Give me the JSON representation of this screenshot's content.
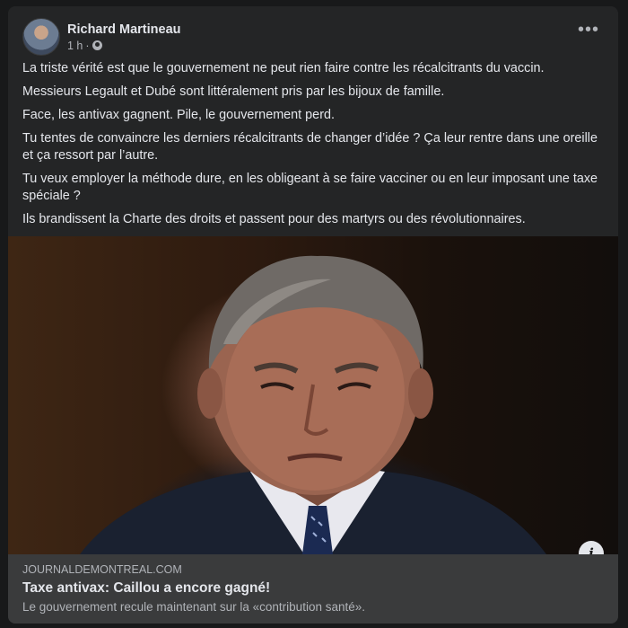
{
  "post": {
    "author": "Richard Martineau",
    "time": "1 h",
    "separator": "·",
    "more_icon": "more-horizontal-icon",
    "privacy_icon": "globe-icon",
    "paragraphs": [
      "La triste vérité est que le gouvernement ne peut rien faire contre les récalcitrants du vaccin.",
      "Messieurs Legault et Dubé sont littéralement pris par les bijoux de famille.",
      "Face, les antivax gagnent. Pile, le gouvernement perd.",
      "Tu tentes de convaincre les derniers récalcitrants de changer d’idée ? Ça leur rentre dans une oreille et ça ressort par l’autre.",
      "Tu veux employer la méthode dure, en les obligeant à se faire vacciner ou en leur imposant une taxe spéciale ?",
      "Ils brandissent la Charte des droits et passent pour des martyrs ou des révolutionnaires."
    ]
  },
  "link": {
    "domain": "JOURNALDEMONTREAL.COM",
    "title": "Taxe antivax: Caillou a encore gagné!",
    "description": "Le gouvernement recule maintenant sur la «contribution santé».",
    "info_label": "i"
  }
}
